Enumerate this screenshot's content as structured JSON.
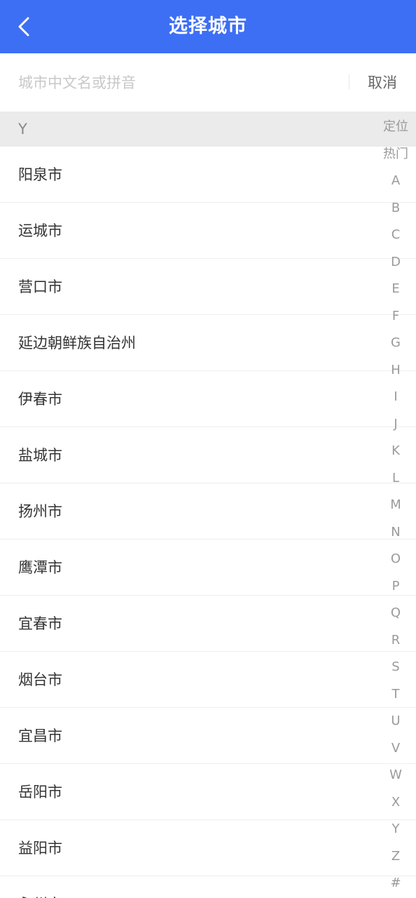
{
  "header": {
    "title": "选择城市",
    "background_color": "#3d6ff5"
  },
  "search": {
    "placeholder": "城市中文名或拼音",
    "cancel_label": "取消"
  },
  "section": {
    "letter": "Y"
  },
  "cities": [
    "阳泉市",
    "运城市",
    "营口市",
    "延边朝鲜族自治州",
    "伊春市",
    "盐城市",
    "扬州市",
    "鹰潭市",
    "宜春市",
    "烟台市",
    "宜昌市",
    "岳阳市",
    "益阳市",
    "永州市"
  ],
  "index_bar": [
    "定位",
    "热门",
    "A",
    "B",
    "C",
    "D",
    "E",
    "F",
    "G",
    "H",
    "I",
    "J",
    "K",
    "L",
    "M",
    "N",
    "O",
    "P",
    "Q",
    "R",
    "S",
    "T",
    "U",
    "V",
    "W",
    "X",
    "Y",
    "Z",
    "#"
  ]
}
